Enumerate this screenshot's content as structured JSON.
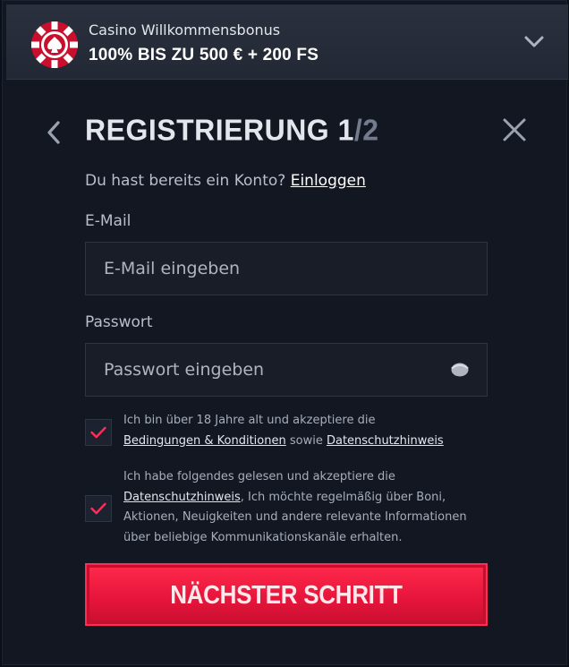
{
  "bonus": {
    "subtitle": "Casino Willkommensbonus",
    "title": "100% BIS ZU 500 € + 200 FS"
  },
  "header": {
    "title_main": "REGISTRIERUNG 1",
    "title_total": "/2"
  },
  "login_prompt": {
    "text": "Du hast bereits ein Konto?",
    "link": "Einloggen"
  },
  "email": {
    "label": "E-Mail",
    "placeholder": "E-Mail eingeben",
    "value": ""
  },
  "password": {
    "label": "Passwort",
    "placeholder": "Passwort eingeben",
    "value": ""
  },
  "consent_terms": {
    "checked": true,
    "text_before": "Ich bin über 18 Jahre alt und akzeptiere die",
    "link_terms": "Bedingungen & Konditionen",
    "text_middle": "sowie",
    "link_privacy": "Datenschutzhinweis"
  },
  "consent_marketing": {
    "checked": true,
    "text_before": "Ich habe folgendes gelesen und akzeptiere die",
    "link_privacy": "Datenschutzhinweis",
    "text_after": ", Ich möchte regelmäßig über Boni, Aktionen, Neuigkeiten und andere relevante Informationen über beliebige Kommunikationskanäle erhalten."
  },
  "next_button": {
    "label": "NÄCHSTER SCHRITT"
  },
  "colors": {
    "accent": "#e5143a",
    "check": "#ff2d55",
    "background": "#121722"
  },
  "icons": {
    "chip": "casino-chip-icon",
    "chevron": "chevron-down-icon",
    "back": "chevron-left-icon",
    "close": "close-icon",
    "eye": "eye-icon",
    "check": "checkmark-icon"
  }
}
